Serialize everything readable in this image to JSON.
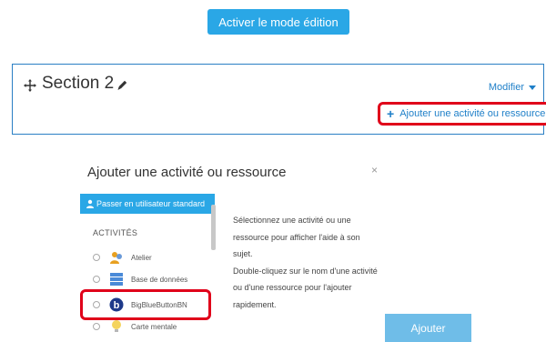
{
  "header": {
    "edit_mode_button": "Activer le mode édition"
  },
  "section": {
    "title": "Section 2",
    "modify_label": "Modifier",
    "add_activity_label": "Ajouter une activité ou ressource"
  },
  "modal": {
    "title": "Ajouter une activité ou ressource",
    "close_symbol": "×",
    "standard_user_button": "Passer en utilisateur standard",
    "activities_heading": "ACTIVITÉS",
    "activities": [
      {
        "label": "Atelier",
        "icon": "workshop-icon"
      },
      {
        "label": "Base de données",
        "icon": "database-icon"
      },
      {
        "label": "BigBlueButtonBN",
        "icon": "bigbluebutton-icon"
      },
      {
        "label": "Carte mentale",
        "icon": "lightbulb-icon"
      }
    ],
    "help_lines": [
      "Sélectionnez une activité ou une",
      "ressource pour afficher l'aide à son sujet.",
      "Double-cliquez sur le nom d'une activité",
      "ou d'une ressource pour l'ajouter",
      "rapidement."
    ],
    "submit_label": "Ajouter"
  },
  "colors": {
    "accent": "#2aa7e6",
    "link": "#1e7fc8",
    "highlight": "#e0001a",
    "submit": "#6fbde8"
  }
}
